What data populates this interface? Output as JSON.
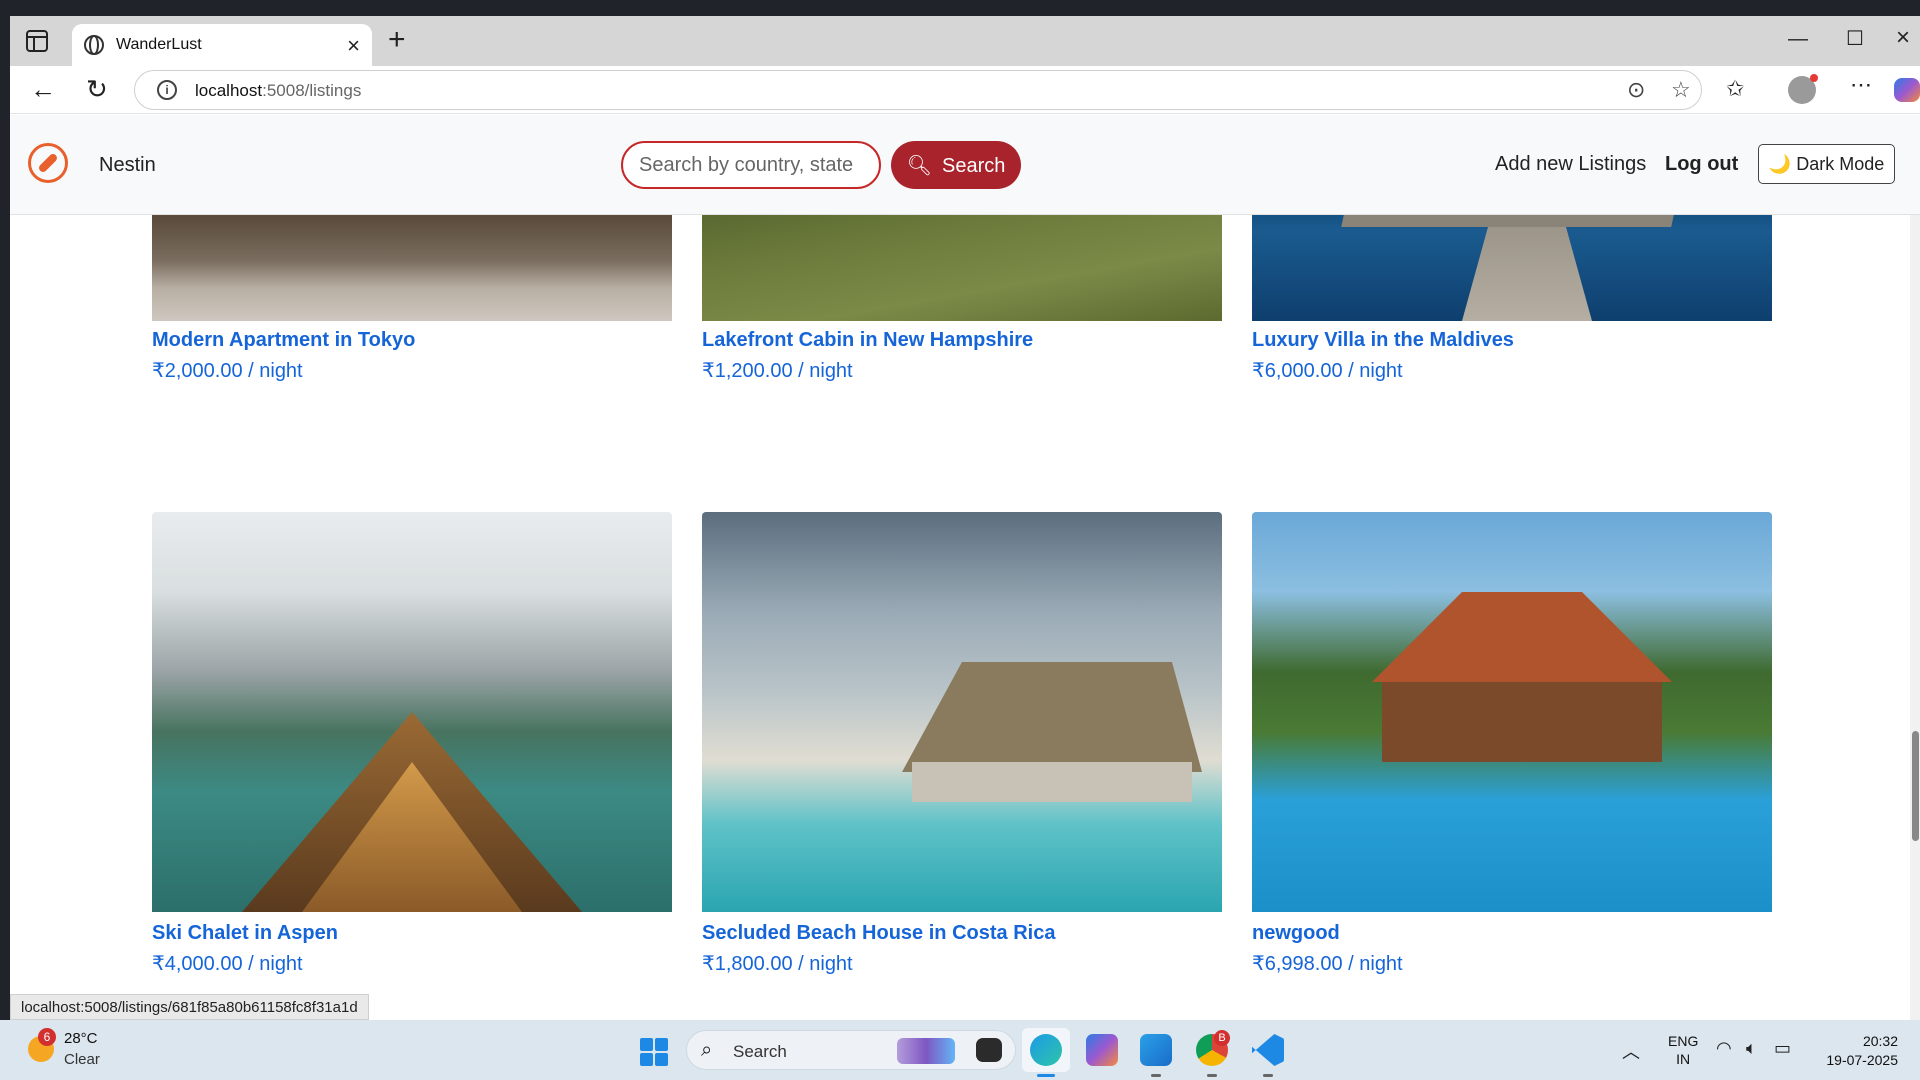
{
  "browser": {
    "tab_title": "WanderLust",
    "url_host": "localhost",
    "url_path": ":5008/listings",
    "status_url": "localhost:5008/listings/681f85a80b61158fc8f31a1d"
  },
  "navbar": {
    "brand": "Nestin",
    "search_placeholder": "Search by country, state",
    "search_label": "Search",
    "add_listing": "Add new Listings",
    "logout": "Log out",
    "dark_mode_icon": "🌙",
    "dark_mode": "Dark Mode"
  },
  "listings": [
    {
      "title": "Modern Apartment in Tokyo",
      "price": "₹2,000.00 / night"
    },
    {
      "title": "Lakefront Cabin in New Hampshire",
      "price": "₹1,200.00 / night"
    },
    {
      "title": "Luxury Villa in the Maldives",
      "price": "₹6,000.00 / night"
    },
    {
      "title": "Ski Chalet in Aspen",
      "price": "₹4,000.00 / night"
    },
    {
      "title": "Secluded Beach House in Costa Rica",
      "price": "₹1,800.00 / night"
    },
    {
      "title": "newgood",
      "price": "₹6,998.00 / night"
    }
  ],
  "taskbar": {
    "weather_badge": "6",
    "temperature": "28°C",
    "condition": "Clear",
    "search_label": "Search",
    "chrome_badge": "B",
    "lang_line1": "ENG",
    "lang_line2": "IN",
    "time": "20:32",
    "date": "19-07-2025"
  },
  "colors": {
    "accent_red": "#a8232b",
    "link_blue": "#1565d8",
    "brand_orange": "#e8602c"
  }
}
